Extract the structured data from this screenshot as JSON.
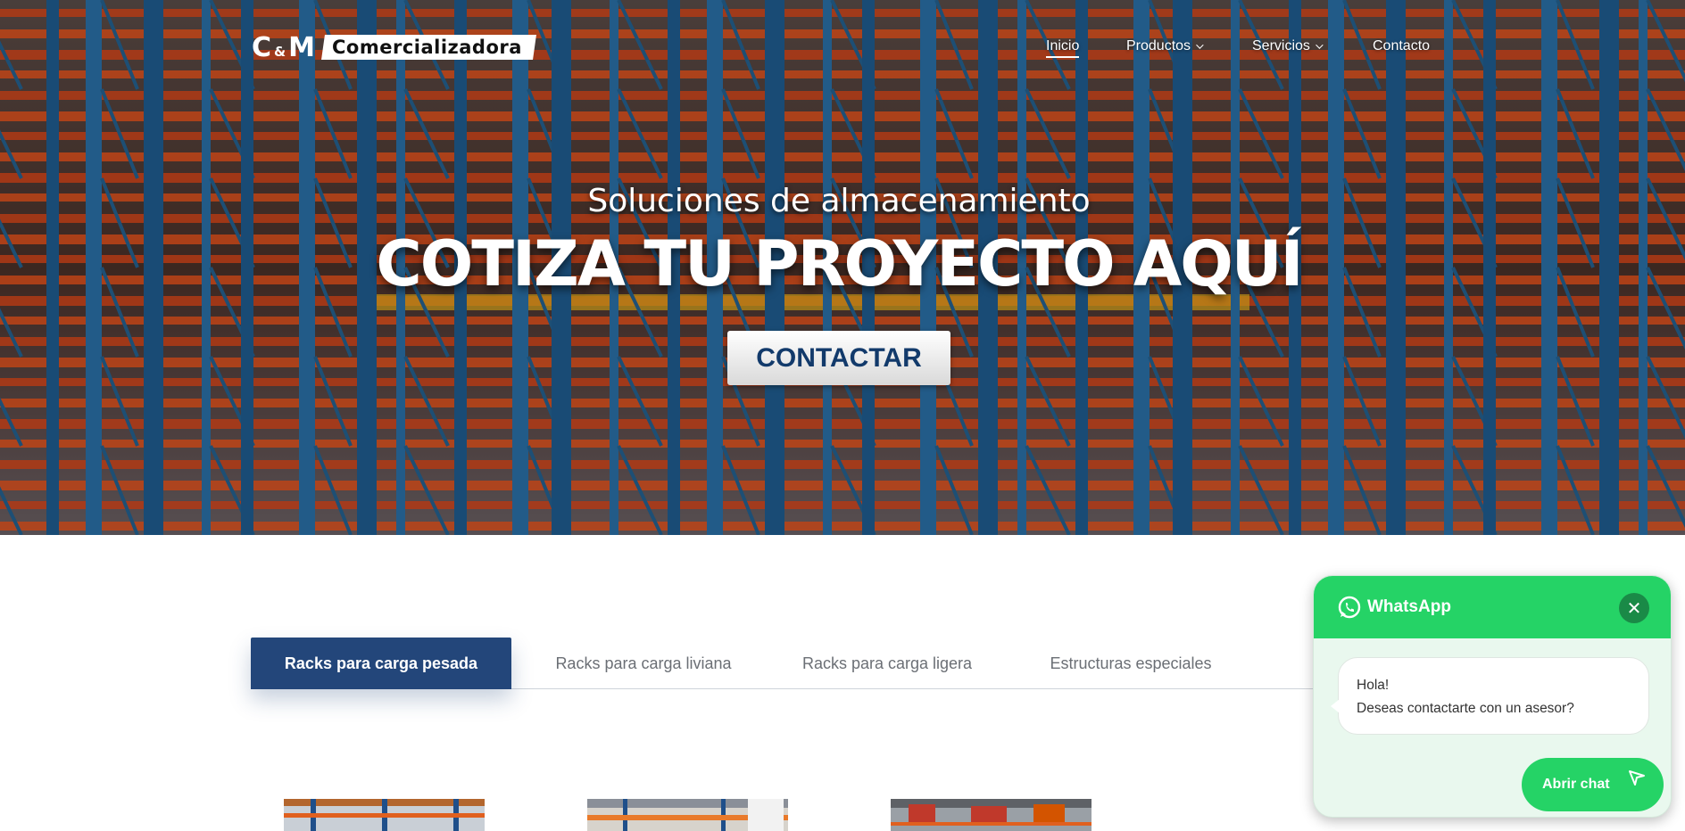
{
  "header": {
    "logo_cm": "C",
    "logo_amp": "&",
    "logo_m": "M",
    "logo_name": "Comercializadora"
  },
  "nav": {
    "items": [
      {
        "label": "Inicio"
      },
      {
        "label": "Productos"
      },
      {
        "label": "Servicios"
      },
      {
        "label": "Contacto"
      }
    ]
  },
  "hero": {
    "subtitle": "Soluciones de almacenamiento",
    "title": "COTIZA TU PROYECTO AQUÍ",
    "cta_label": "CONTACTAR"
  },
  "tabs": [
    {
      "label": "Racks para carga pesada",
      "active": true
    },
    {
      "label": "Racks para carga liviana",
      "active": false
    },
    {
      "label": "Racks para carga ligera",
      "active": false
    },
    {
      "label": "Estructuras especiales",
      "active": false
    }
  ],
  "whatsapp": {
    "title": "WhatsApp",
    "close_symbol": "✕",
    "message_line1": "Hola!",
    "message_line2": "Deseas contactarte con un asesor?",
    "button_label": "Abrir chat"
  },
  "colors": {
    "tab_active": "#23467a",
    "cta_text": "#123a6b",
    "whatsapp_green": "#25d366"
  }
}
